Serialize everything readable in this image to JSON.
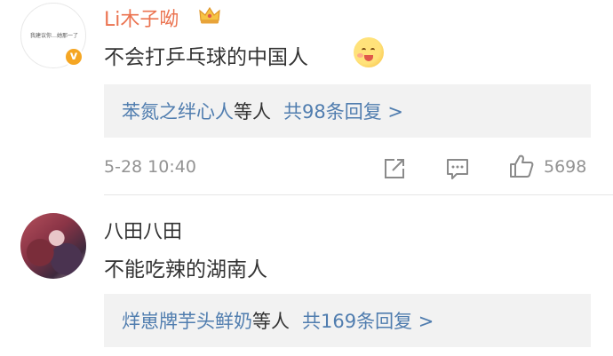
{
  "comments": [
    {
      "username": "Li木子呦",
      "avatar_text": "我建议你…她那一了",
      "verified_badge": "v",
      "badge_icon": "crown-icon",
      "text": "不会打乒乓球的中国人",
      "emoji_icon": "savoring-face-emoji-icon",
      "reply": {
        "users": "苯氮之绊心人",
        "suffix": "等人",
        "count_text": "共98条回复 >"
      },
      "timestamp": "5-28 10:40",
      "likes": "5698",
      "name_color": "#eb7350"
    },
    {
      "username": "八田八田",
      "text": "不能吃辣的湖南人",
      "reply": {
        "users": "烊崽牌芋头鲜奶",
        "suffix": "等人",
        "count_text": "共169条回复 >"
      }
    }
  ],
  "colors": {
    "link": "#507daf",
    "meta": "#939393",
    "reply_bg": "#f2f2f2"
  }
}
